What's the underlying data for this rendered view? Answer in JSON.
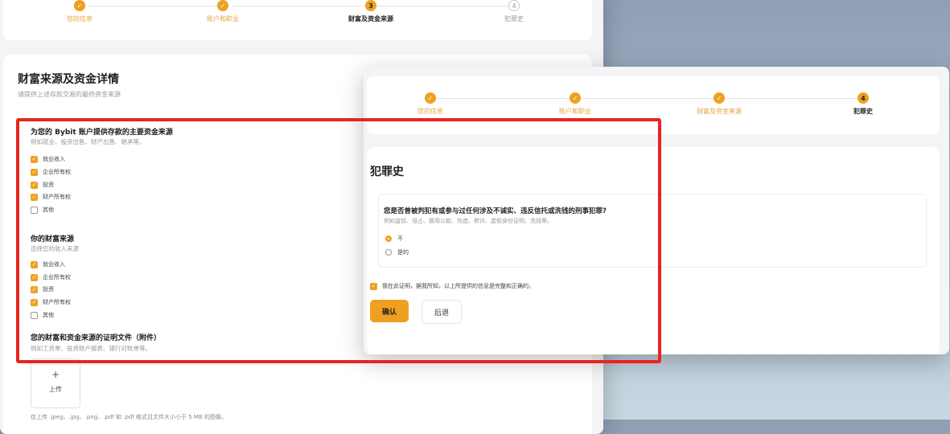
{
  "back_window": {
    "steps": [
      {
        "label": "您的信息",
        "state": "done"
      },
      {
        "label": "账户和职业",
        "state": "done"
      },
      {
        "label": "财富及资金来源",
        "state": "current",
        "num": "3"
      },
      {
        "label": "犯罪史",
        "state": "todo",
        "num": "4"
      }
    ],
    "title": "财富来源及资金详情",
    "subtitle": "请提供上述存款交易的最终资金来源",
    "q1": {
      "title": "为您的 Bybit 账户提供存款的主要资金来源",
      "hint": "例如就业、投资出售、财产出售、继承等。",
      "options": [
        {
          "label": "就业收入",
          "checked": true
        },
        {
          "label": "企业所有权",
          "checked": true
        },
        {
          "label": "投资",
          "checked": true
        },
        {
          "label": "财产所有权",
          "checked": true
        },
        {
          "label": "其他",
          "checked": false
        }
      ]
    },
    "q2": {
      "title": "你的财富来源",
      "hint": "选择您的收入来源",
      "options": [
        {
          "label": "就业收入",
          "checked": true
        },
        {
          "label": "企业所有权",
          "checked": true
        },
        {
          "label": "投资",
          "checked": true
        },
        {
          "label": "财产所有权",
          "checked": true
        },
        {
          "label": "其他",
          "checked": false
        }
      ]
    },
    "q3": {
      "title": "您的财富和资金来源的证明文件（附件）",
      "hint": "例如工资单、投资账户报表、银行对账单等。"
    },
    "upload": {
      "plus": "+",
      "label": "上传"
    },
    "upload_note": "仅上传 .jpeg、.jpg、.png、.pdf 和 .pdf 格式且文件大小小于 5 MB 的图像。"
  },
  "front_window": {
    "steps": [
      {
        "label": "您的信息",
        "state": "done"
      },
      {
        "label": "账户和职业",
        "state": "done"
      },
      {
        "label": "财富及资金来源",
        "state": "done"
      },
      {
        "label": "犯罪史",
        "state": "current",
        "num": "4"
      }
    ],
    "title": "犯罪史",
    "question": "您是否曾被判犯有或参与过任何涉及不诚实、违反信托或洗钱的刑事犯罪?",
    "hint": "例如盗窃、侵占、挪用公款、伪造、欺诈、虚假身份证明、洗钱等。",
    "radio": [
      {
        "label": "不",
        "selected": true
      },
      {
        "label": "是的",
        "selected": false
      }
    ],
    "declaration": "我在此证明，据我所知，以上所提供的信息是完整和正确的。",
    "confirm_label": "确认",
    "back_label": "后退"
  },
  "colors": {
    "accent": "#f0a020",
    "highlight": "#e8241c"
  },
  "icons": {
    "check": "✓"
  }
}
